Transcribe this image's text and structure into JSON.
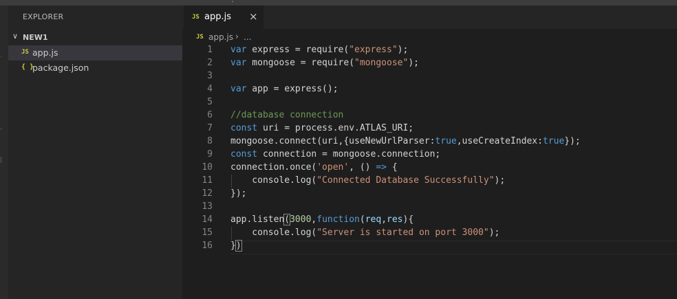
{
  "sidebar": {
    "title": "EXPLORER",
    "folder": "NEW1",
    "files": [
      {
        "icon": "JS",
        "name": "app.js"
      },
      {
        "icon": "{ }",
        "name": "package.json"
      }
    ]
  },
  "tab": {
    "icon": "JS",
    "label": "app.js",
    "close": "×"
  },
  "breadcrumb": {
    "icon": "JS",
    "file": "app.js",
    "sep": "›",
    "ellipsis": "..."
  },
  "editor": {
    "lines": [
      [
        [
          "kw",
          "var"
        ],
        [
          "id",
          " express = require("
        ],
        [
          "str",
          "\"express\""
        ],
        [
          "id",
          ");"
        ]
      ],
      [
        [
          "kw",
          "var"
        ],
        [
          "id",
          " mongoose = require("
        ],
        [
          "str",
          "\"mongoose\""
        ],
        [
          "id",
          ");"
        ]
      ],
      [],
      [
        [
          "kw",
          "var"
        ],
        [
          "id",
          " app = express();"
        ]
      ],
      [],
      [
        [
          "com",
          "//database connection"
        ]
      ],
      [
        [
          "kw",
          "const"
        ],
        [
          "id",
          " uri = process.env.ATLAS_URI;"
        ]
      ],
      [
        [
          "id",
          "mongoose.connect(uri,{useNewUrlParser:"
        ],
        [
          "kw",
          "true"
        ],
        [
          "id",
          ",useCreateIndex:"
        ],
        [
          "kw",
          "true"
        ],
        [
          "id",
          "});"
        ]
      ],
      [
        [
          "kw",
          "const"
        ],
        [
          "id",
          " connection = mongoose.connection;"
        ]
      ],
      [
        [
          "id",
          "connection.once("
        ],
        [
          "str",
          "'open'"
        ],
        [
          "id",
          ", () "
        ],
        [
          "kw",
          "=>"
        ],
        [
          "id",
          " {"
        ]
      ],
      [
        [
          "id",
          "    console.log("
        ],
        [
          "str",
          "\"Connected Database Successfully\""
        ],
        [
          "id",
          ");"
        ]
      ],
      [
        [
          "id",
          "});"
        ]
      ],
      [],
      [
        [
          "id",
          "app.listen"
        ],
        [
          "br",
          "("
        ],
        [
          "num",
          "3000"
        ],
        [
          "id",
          ","
        ],
        [
          "kw",
          "function"
        ],
        [
          "id",
          "("
        ],
        [
          "par",
          "req"
        ],
        [
          "id",
          ","
        ],
        [
          "par",
          "res"
        ],
        [
          "id",
          "){"
        ]
      ],
      [
        [
          "id",
          "    console.log("
        ],
        [
          "str",
          "\"Server is started on port 3000\""
        ],
        [
          "id",
          ");"
        ]
      ],
      [
        [
          "id",
          "}"
        ],
        [
          "br",
          ")"
        ]
      ]
    ]
  },
  "colors": {
    "background": "#1e1e1e",
    "sidebar": "#252526",
    "keyword": "#569cd6",
    "string": "#ce9178",
    "comment": "#6a9955",
    "number": "#b5cea8"
  }
}
